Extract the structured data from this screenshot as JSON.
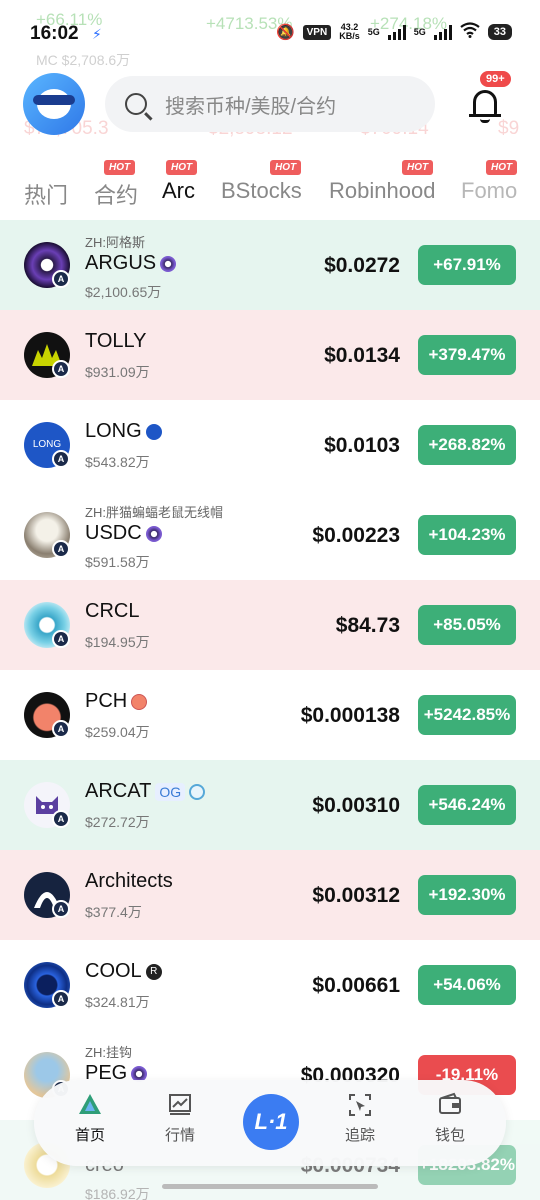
{
  "status_bar": {
    "time": "16:02",
    "vpn": "VPN",
    "net_speed_value": "43.2",
    "net_speed_unit": "KB/s",
    "network_1": "5G",
    "network_2": "5G",
    "battery": "33"
  },
  "ticker_ghost": {
    "row1_left": "+66.11%",
    "row1_mid": "+4713.53%",
    "row1_right": "+274.18%",
    "mc": "MC $2,708.6万",
    "row2_a": "$75,705.3",
    "row2_b": "$2,898.12",
    "row2_c": "$709.14",
    "row2_d": "$9"
  },
  "header": {
    "search_placeholder": "搜索币种/美股/合约",
    "notification_count": "99+"
  },
  "tabs": [
    {
      "label": "热门",
      "hot": ""
    },
    {
      "label": "合约",
      "hot": "HOT"
    },
    {
      "label": "Arc",
      "hot": "HOT"
    },
    {
      "label": "BStocks",
      "hot": "HOT"
    },
    {
      "label": "Robinhood",
      "hot": "HOT"
    },
    {
      "label": "Fomo",
      "hot": "HOT"
    }
  ],
  "active_tab": "Arc",
  "tokens": [
    {
      "subtitle": "ZH:阿格斯",
      "symbol": "ARGUS",
      "market_cap": "$2,100.65万",
      "price": "$0.0272",
      "change": "+67.91%",
      "direction": "up",
      "row_tint": "green",
      "icon": "argus-eye-icon"
    },
    {
      "subtitle": "",
      "symbol": "TOLLY",
      "market_cap": "$931.09万",
      "price": "$0.0134",
      "change": "+379.47%",
      "direction": "up",
      "row_tint": "red",
      "icon": "tolly-icon"
    },
    {
      "subtitle": "",
      "symbol": "LONG",
      "market_cap": "$543.82万",
      "price": "$0.0103",
      "change": "+268.82%",
      "direction": "up",
      "row_tint": "none",
      "icon": "long-icon"
    },
    {
      "subtitle": "ZH:胖猫蝙蝠老鼠无线帽",
      "symbol": "USDC",
      "market_cap": "$591.58万",
      "price": "$0.00223",
      "change": "+104.23%",
      "direction": "up",
      "row_tint": "none",
      "icon": "usdc-cat-icon"
    },
    {
      "subtitle": "",
      "symbol": "CRCL",
      "market_cap": "$194.95万",
      "price": "$84.73",
      "change": "+85.05%",
      "direction": "up",
      "row_tint": "red",
      "icon": "crcl-icon"
    },
    {
      "subtitle": "",
      "symbol": "PCH",
      "market_cap": "$259.04万",
      "price": "$0.000138",
      "change": "+5242.85%",
      "direction": "up",
      "row_tint": "none",
      "icon": "pch-icon"
    },
    {
      "subtitle": "",
      "symbol": "ARCAT",
      "tag": "OG",
      "market_cap": "$272.72万",
      "price": "$0.00310",
      "change": "+546.24%",
      "direction": "up",
      "row_tint": "green",
      "icon": "arcat-icon"
    },
    {
      "subtitle": "",
      "symbol": "Architects",
      "market_cap": "$377.4万",
      "price": "$0.00312",
      "change": "+192.30%",
      "direction": "up",
      "row_tint": "red",
      "icon": "architects-icon"
    },
    {
      "subtitle": "",
      "symbol": "COOL",
      "market_cap": "$324.81万",
      "price": "$0.00661",
      "change": "+54.06%",
      "direction": "up",
      "row_tint": "none",
      "icon": "cool-icon"
    },
    {
      "subtitle": "ZH:挂钩",
      "symbol": "PEG",
      "market_cap": "",
      "price": "$0.000320",
      "change": "-19.11%",
      "direction": "down",
      "row_tint": "none",
      "icon": "peg-icon"
    },
    {
      "subtitle": "",
      "symbol": "creo",
      "market_cap": "$186.92万",
      "price": "$0.000734",
      "change": "+18203.82%",
      "direction": "up",
      "row_tint": "none",
      "icon": "creo-icon"
    }
  ],
  "bottom_nav": {
    "home": "首页",
    "market": "行情",
    "track": "追踪",
    "wallet": "钱包"
  },
  "colors": {
    "up": "#3daf78",
    "down": "#ea4c4f",
    "accent": "#3b7cf2"
  }
}
